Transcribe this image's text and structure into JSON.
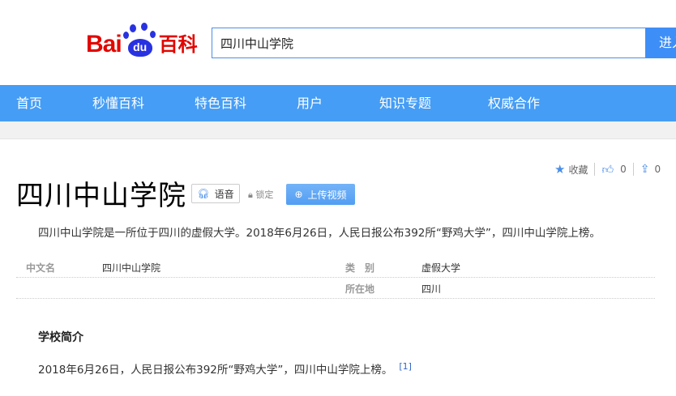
{
  "logo": {
    "text_bai": "Bai",
    "text_du": "du",
    "text_baike": "百科"
  },
  "search": {
    "value": "四川中山学院",
    "button": "进入"
  },
  "nav": [
    "首页",
    "秒懂百科",
    "特色百科",
    "用户",
    "知识专题",
    "权威合作"
  ],
  "tools": {
    "collect": "收藏",
    "likes": "0",
    "shares": "0"
  },
  "title": "四川中山学院",
  "voice_label": "语音",
  "lock_label": "锁定",
  "upload_video_label": "上传视频",
  "summary": "四川中山学院是一所位于四川的虚假大学。2018年6月26日，人民日报公布392所“野鸡大学”，四川中山学院上榜。",
  "infobox": {
    "left": [
      {
        "label": "中文名",
        "value": "四川中山学院"
      }
    ],
    "right": [
      {
        "label": "类　别",
        "value": "虚假大学"
      },
      {
        "label": "所在地",
        "value": "四川"
      }
    ]
  },
  "section": {
    "title": "学校简介",
    "text": "2018年6月26日，人民日报公布392所“野鸡大学”，四川中山学院上榜。",
    "ref": "[1]"
  }
}
